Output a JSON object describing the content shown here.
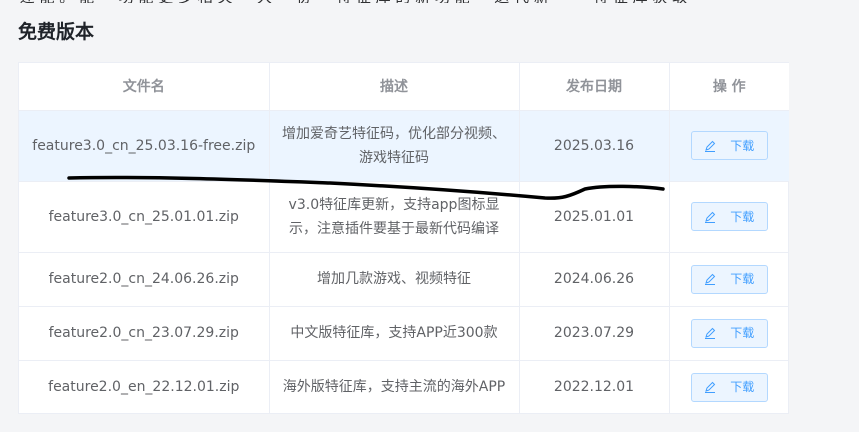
{
  "section": {
    "title": "免费版本"
  },
  "table": {
    "headers": {
      "filename": "文件名",
      "description": "描述",
      "release_date": "发布日期",
      "action": "操 作"
    },
    "rows": [
      {
        "filename": "feature3.0_cn_25.03.16-free.zip",
        "desc_line1": "增加爱奇艺特征码，优化部分视频、",
        "desc_line2": "游戏特征码",
        "date": "2025.03.16",
        "action": "下载",
        "highlighted": true
      },
      {
        "filename": "feature3.0_cn_25.01.01.zip",
        "desc_line1": "v3.0特征库更新，支持app图标显",
        "desc_line2": "示，注意插件要基于最新代码编译",
        "date": "2025.01.01",
        "action": "下载"
      },
      {
        "filename": "feature2.0_cn_24.06.26.zip",
        "desc_line1": "增加几款游戏、视频特征",
        "desc_line2": "",
        "date": "2024.06.26",
        "action": "下载"
      },
      {
        "filename": "feature2.0_cn_23.07.29.zip",
        "desc_line1": "中文版特征库，支持APP近300款",
        "desc_line2": "",
        "date": "2023.07.29",
        "action": "下载"
      },
      {
        "filename": "feature2.0_en_22.12.01.zip",
        "desc_line1": "海外版特征库，支持主流的海外APP",
        "desc_line2": "",
        "date": "2022.12.01",
        "action": "下载"
      }
    ]
  },
  "icons": {
    "download_button_icon": "edit-pen-icon"
  },
  "colors": {
    "accent": "#409eff",
    "highlight_row": "#ecf5ff",
    "button_border": "#b3d8ff",
    "annotation_stroke": "#000000"
  }
}
